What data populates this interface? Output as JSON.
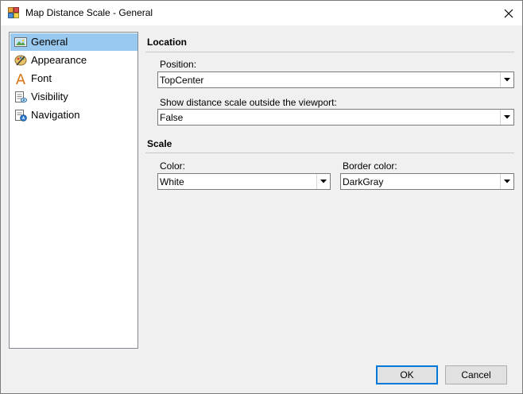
{
  "window": {
    "title": "Map Distance Scale - General",
    "close_icon": "close-icon"
  },
  "nav": {
    "items": [
      {
        "label": "General",
        "icon": "general-icon",
        "selected": true
      },
      {
        "label": "Appearance",
        "icon": "appearance-icon",
        "selected": false
      },
      {
        "label": "Font",
        "icon": "font-icon",
        "selected": false
      },
      {
        "label": "Visibility",
        "icon": "visibility-icon",
        "selected": false
      },
      {
        "label": "Navigation",
        "icon": "navigation-icon",
        "selected": false
      }
    ]
  },
  "location": {
    "title": "Location",
    "position": {
      "label": "Position:",
      "value": "TopCenter"
    },
    "outside": {
      "label": "Show distance scale outside the viewport:",
      "value": "False"
    }
  },
  "scale": {
    "title": "Scale",
    "color": {
      "label": "Color:",
      "value": "White"
    },
    "border_color": {
      "label": "Border color:",
      "value": "DarkGray"
    }
  },
  "buttons": {
    "ok": "OK",
    "cancel": "Cancel"
  },
  "colors": {
    "selection": "#99c9ef",
    "accent": "#0078d7"
  }
}
